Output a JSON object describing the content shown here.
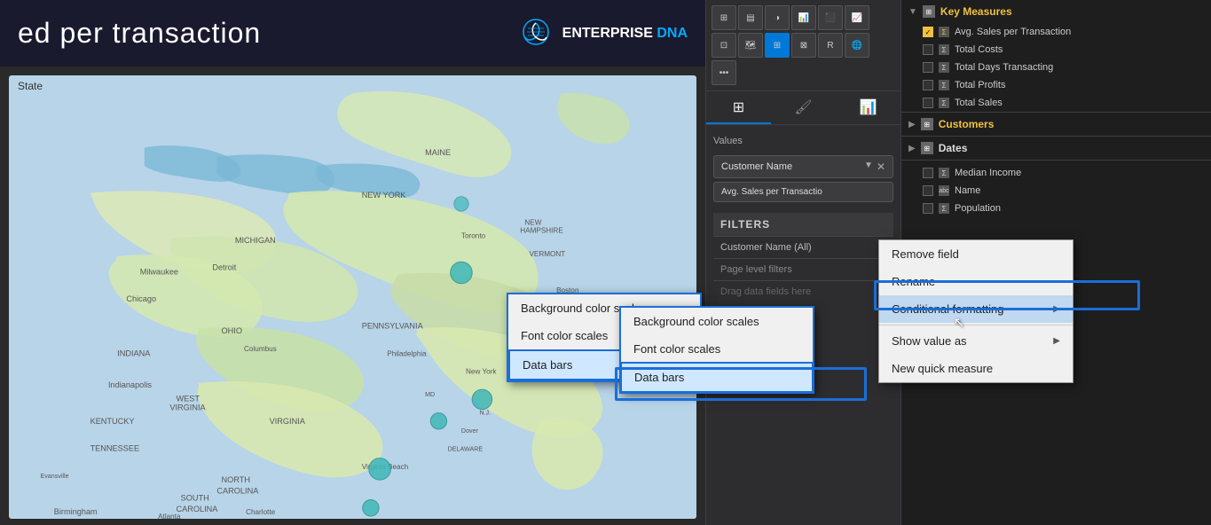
{
  "header": {
    "title": "ed per transaction",
    "logo_dna": "🧬",
    "logo_enterprise": "ENTERPRISE",
    "logo_dna_text": "DNA"
  },
  "map": {
    "label": "State"
  },
  "visualizations_panel": {
    "tabs": [
      {
        "label": "⊞",
        "id": "table-tab"
      },
      {
        "label": "🖌",
        "id": "format-tab"
      },
      {
        "label": "📊",
        "id": "analytics-tab"
      }
    ],
    "values_label": "Values",
    "field_customer_name": "Customer Name",
    "field_avg_sales": "Avg. Sales per Transactio",
    "filters_header": "FILTERS",
    "filter_customer_name": "Customer Name (All)",
    "page_level_filters": "Page level filters",
    "drag_data_fields": "Drag data fields here"
  },
  "context_menu_main": {
    "items": [
      {
        "label": "Remove field",
        "id": "remove-field",
        "has_submenu": false
      },
      {
        "label": "Rename",
        "id": "rename",
        "has_submenu": false
      },
      {
        "label": "Conditional formatting",
        "id": "conditional-formatting",
        "has_submenu": true,
        "highlighted": true
      },
      {
        "label": "Show value as",
        "id": "show-value-as",
        "has_submenu": true
      },
      {
        "label": "New quick measure",
        "id": "new-quick-measure",
        "has_submenu": false
      }
    ]
  },
  "context_menu_secondary": {
    "items": [
      {
        "label": "Background color scales",
        "id": "bg-color-scales"
      },
      {
        "label": "Font color scales",
        "id": "font-color-scales"
      },
      {
        "label": "Data bars",
        "id": "data-bars",
        "highlighted": true
      }
    ]
  },
  "data_fields": {
    "groups": [
      {
        "id": "key-measures",
        "name": "Key Measures",
        "icon": "⊞",
        "color": "yellow",
        "expanded": true,
        "items": [
          {
            "label": "Avg. Sales per Transaction",
            "checked": true,
            "type": "Σ"
          },
          {
            "label": "Total Costs",
            "checked": false,
            "type": "Σ"
          },
          {
            "label": "Total Days Transacting",
            "checked": false,
            "type": "Σ"
          },
          {
            "label": "Total Profits",
            "checked": false,
            "type": "Σ"
          },
          {
            "label": "Total Sales",
            "checked": false,
            "type": "Σ"
          }
        ]
      },
      {
        "id": "customers",
        "name": "Customers",
        "icon": "⊞",
        "color": "yellow",
        "expanded": false,
        "items": []
      },
      {
        "id": "dates",
        "name": "Dates",
        "icon": "⊞",
        "color": "white",
        "expanded": false,
        "items": []
      }
    ],
    "customers_fields": [
      {
        "label": "Median Income",
        "checked": false,
        "type": "Σ"
      },
      {
        "label": "Name",
        "checked": false,
        "type": "abc"
      },
      {
        "label": "Population",
        "checked": false,
        "type": "Σ"
      }
    ]
  }
}
